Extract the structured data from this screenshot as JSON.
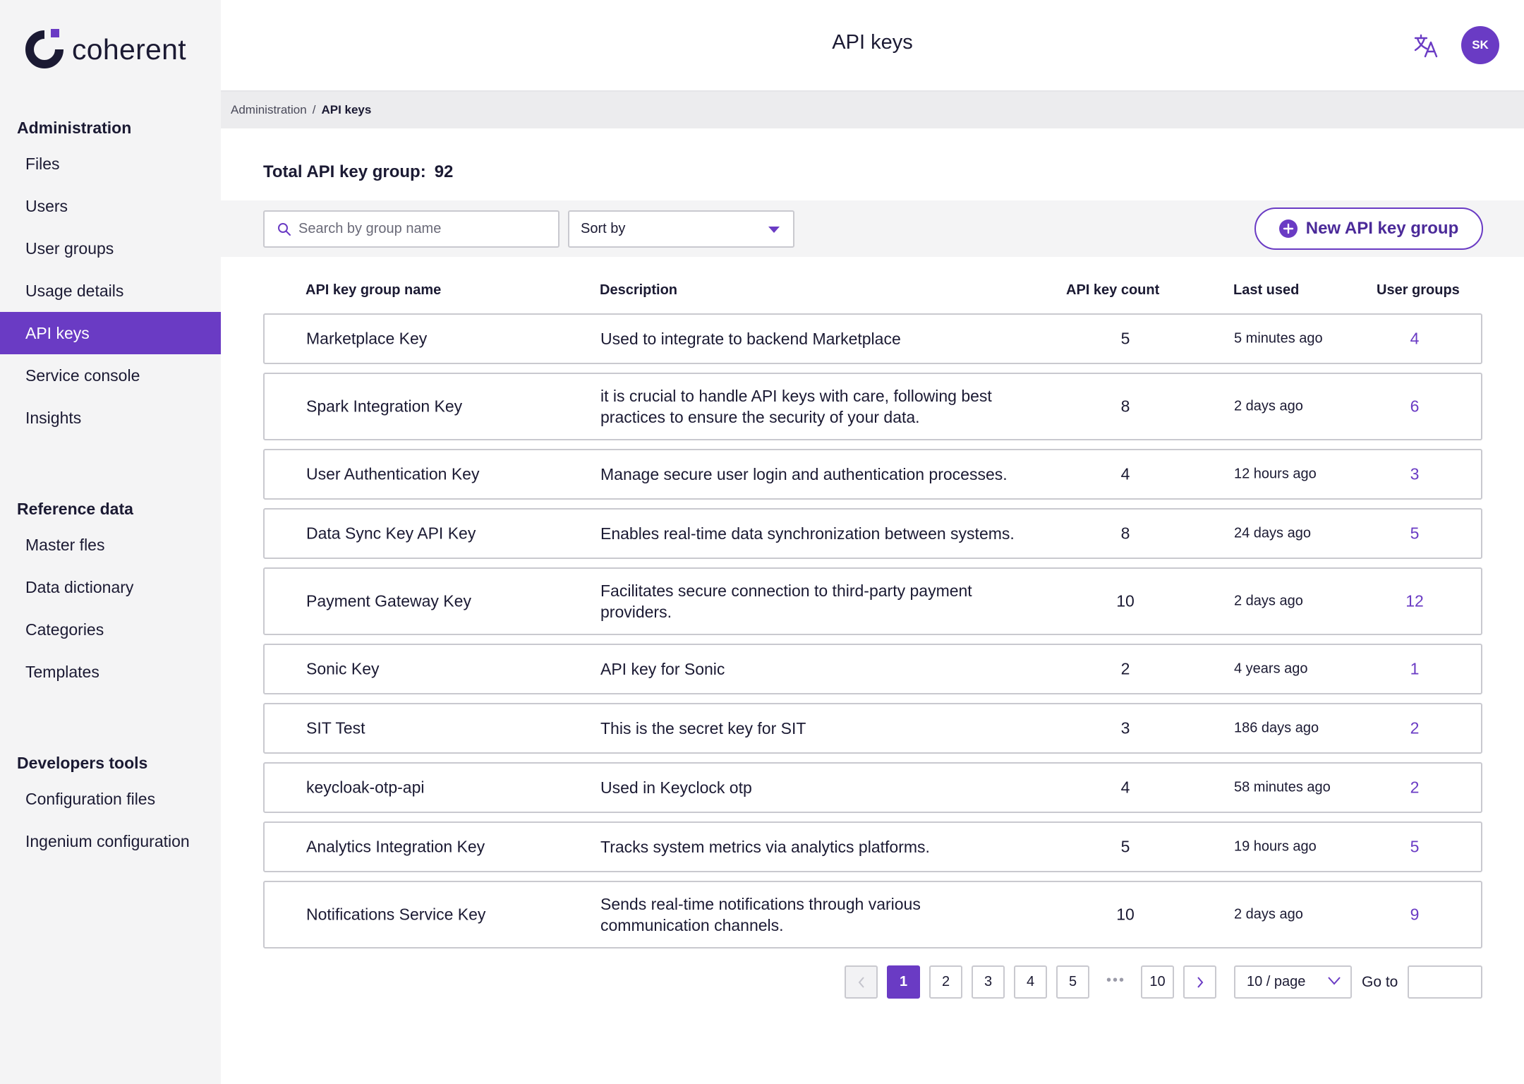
{
  "app": {
    "name": "coherent"
  },
  "header": {
    "title": "API keys",
    "avatar_initials": "SK",
    "translate_icon": "translate-icon"
  },
  "breadcrumb": {
    "parent": "Administration",
    "separator": "/",
    "current": "API keys"
  },
  "sidebar": {
    "sections": [
      {
        "heading": "Administration",
        "items": [
          {
            "label": "Files"
          },
          {
            "label": "Users"
          },
          {
            "label": "User groups"
          },
          {
            "label": "Usage details"
          },
          {
            "label": "API keys",
            "active": true
          },
          {
            "label": "Service console"
          },
          {
            "label": "Insights"
          }
        ]
      },
      {
        "heading": "Reference data",
        "items": [
          {
            "label": "Master fles"
          },
          {
            "label": "Data dictionary"
          },
          {
            "label": "Categories"
          },
          {
            "label": "Templates"
          }
        ]
      },
      {
        "heading": "Developers tools",
        "items": [
          {
            "label": "Configuration  files"
          },
          {
            "label": "Ingenium configuration"
          }
        ]
      }
    ]
  },
  "summary": {
    "label": "Total API key group:",
    "value": "92"
  },
  "toolbar": {
    "search_placeholder": "Search by group name",
    "sort_label": "Sort by",
    "new_button_label": "New API key group"
  },
  "table": {
    "columns": [
      "API key group name",
      "Description",
      "API key count",
      "Last used",
      "User groups"
    ],
    "rows": [
      {
        "name": "Marketplace Key",
        "desc": [
          "Used to integrate to backend Marketplace"
        ],
        "count": "5",
        "last": "5 minutes ago",
        "groups": "4"
      },
      {
        "name": "Spark Integration Key",
        "desc": [
          "it is crucial to handle API keys with care, following best",
          "practices to ensure the security of your data."
        ],
        "count": "8",
        "last": "2 days ago",
        "groups": "6"
      },
      {
        "name": "User Authentication Key",
        "desc": [
          "Manage secure user login and authentication processes."
        ],
        "count": "4",
        "last": "12 hours ago",
        "groups": "3"
      },
      {
        "name": "Data Sync Key API Key",
        "desc": [
          "Enables real-time data synchronization between systems."
        ],
        "count": "8",
        "last": "24 days ago",
        "groups": "5"
      },
      {
        "name": "Payment Gateway Key",
        "desc": [
          "Facilitates secure connection to third-party payment",
          "providers."
        ],
        "count": "10",
        "last": "2 days ago",
        "groups": "12"
      },
      {
        "name": "Sonic Key",
        "desc": [
          "API key for Sonic"
        ],
        "count": "2",
        "last": "4 years ago",
        "groups": "1"
      },
      {
        "name": "SIT Test",
        "desc": [
          "This is the secret key for SIT"
        ],
        "count": "3",
        "last": "186 days ago",
        "groups": "2"
      },
      {
        "name": "keycloak-otp-api",
        "desc": [
          "Used in Keyclock otp"
        ],
        "count": "4",
        "last": "58 minutes ago",
        "groups": "2"
      },
      {
        "name": "Analytics Integration Key",
        "desc": [
          "Tracks system metrics via analytics platforms."
        ],
        "count": "5",
        "last": "19 hours ago",
        "groups": "5"
      },
      {
        "name": "Notifications Service Key",
        "desc": [
          "Sends real-time notifications through various",
          "communication channels."
        ],
        "count": "10",
        "last": "2 days ago",
        "groups": "9"
      }
    ]
  },
  "pagination": {
    "pages": [
      "1",
      "2",
      "3",
      "4",
      "5"
    ],
    "ellipsis": "•••",
    "last_page": "10",
    "current": "1",
    "page_size": "10 / page",
    "goto_label": "Go to"
  },
  "colors": {
    "accent": "#6a3bc4",
    "sidebar_bg": "#f4f4f5",
    "text": "#1b1a33"
  }
}
